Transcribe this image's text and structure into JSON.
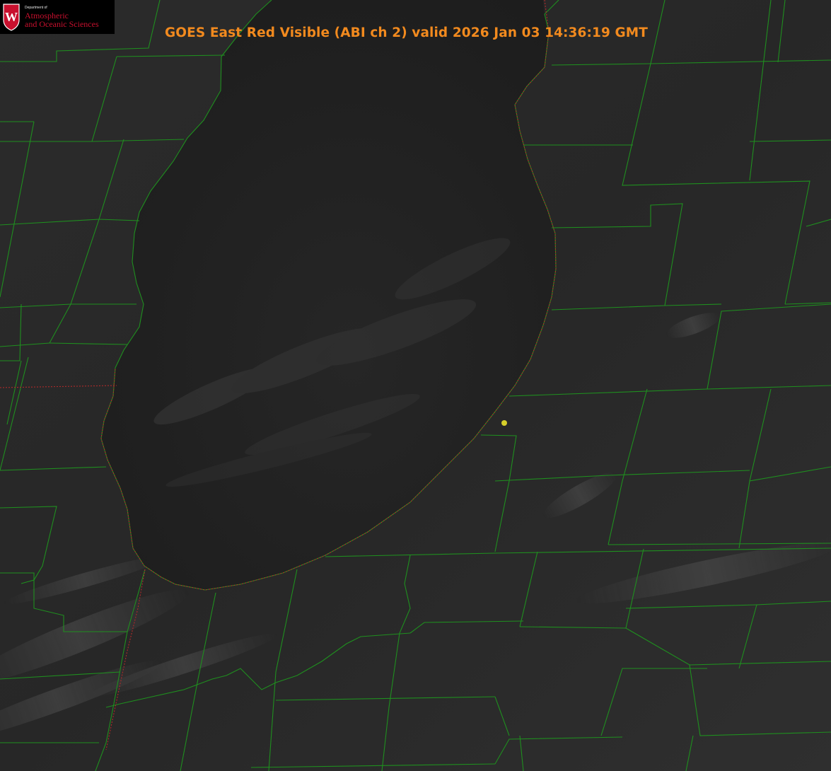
{
  "product": {
    "title": "GOES East Red Visible (ABI ch 2) valid 2026 Jan 03 14:36:19 GMT"
  },
  "logo": {
    "department_line": "Department of",
    "line1": "Atmospheric",
    "line2": "and Oceanic Sciences",
    "crest_letter": "W",
    "crest_color": "#c8102e",
    "text_color": "#c8102e"
  },
  "map": {
    "imagery": "visible satellite, grayscale",
    "features": [
      "lake-outline",
      "county-borders",
      "state-border",
      "site-marker"
    ],
    "colors": {
      "county_border": "#1f8f1f",
      "state_border": "#b02a2a",
      "marker": "#d6cf2a",
      "title": "#f28a1e"
    }
  }
}
